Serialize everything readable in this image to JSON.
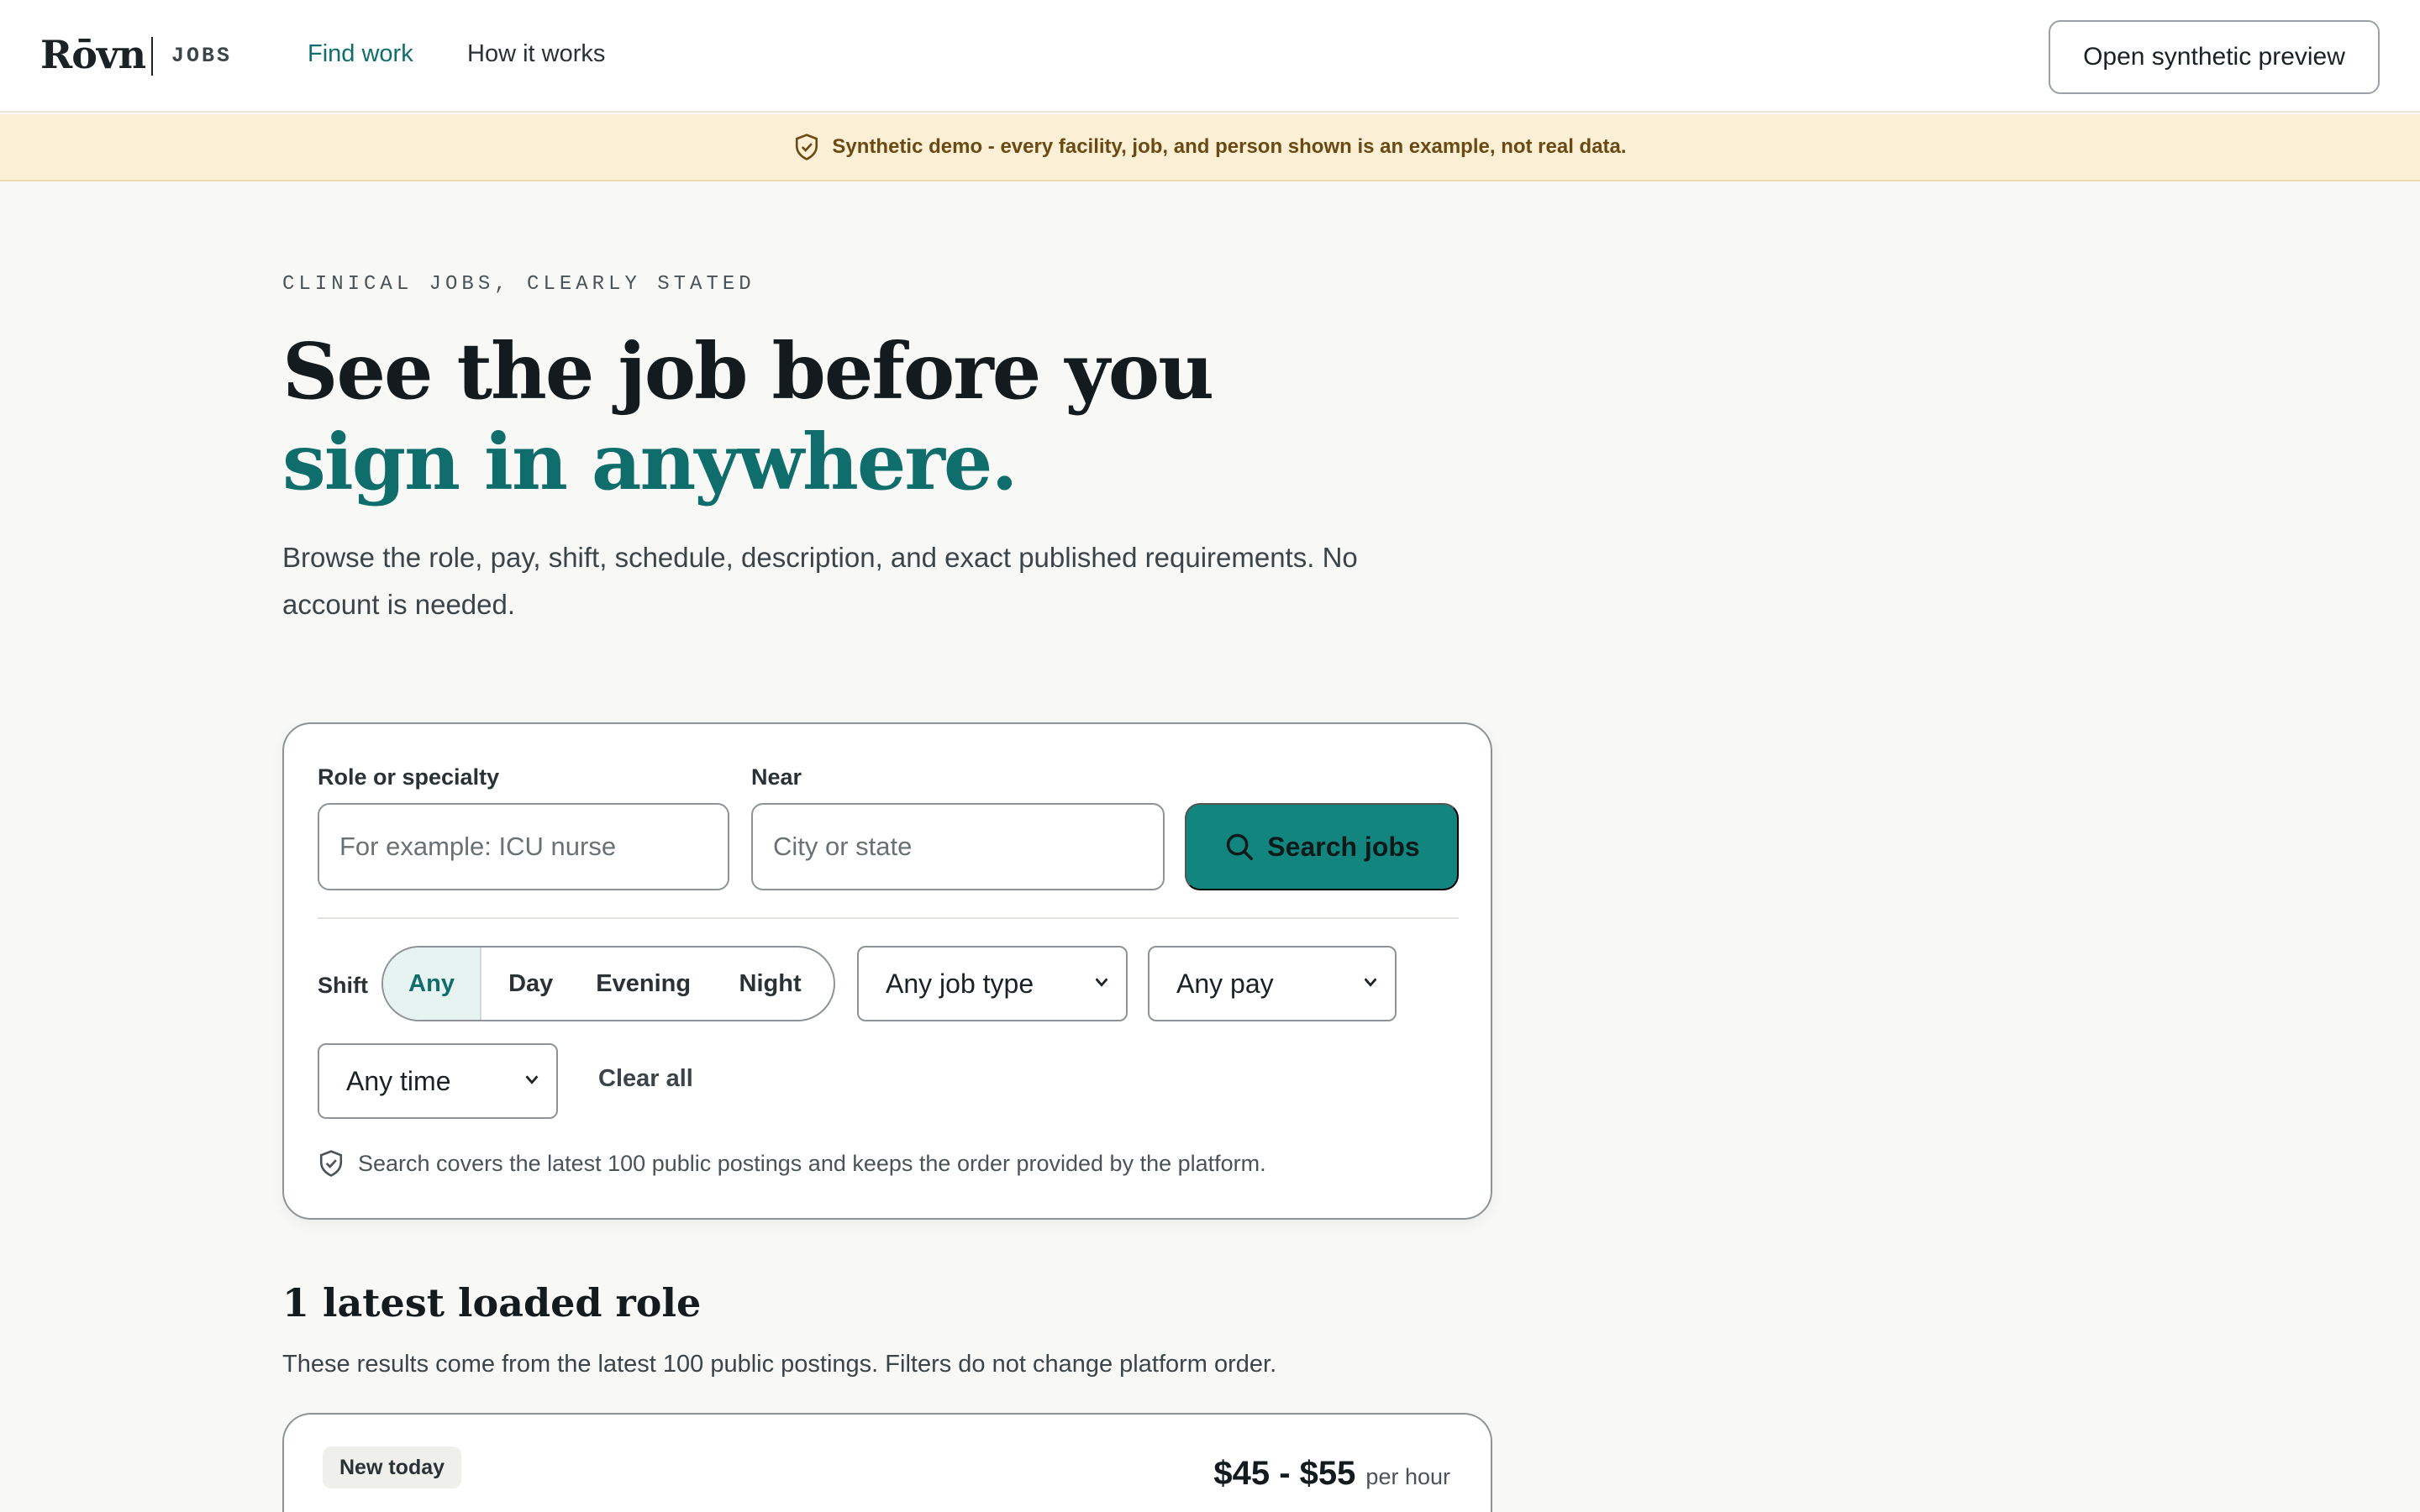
{
  "header": {
    "logo": "Rōvn",
    "logo_sub": "JOBS",
    "nav": [
      {
        "label": "Find work",
        "active": true
      },
      {
        "label": "How it works",
        "active": false
      }
    ],
    "preview_button": "Open synthetic preview"
  },
  "banner": {
    "text": "Synthetic demo - every facility, job, and person shown is an example, not real data.",
    "icon": "shield-check-icon"
  },
  "hero": {
    "eyebrow": "CLINICAL JOBS, CLEARLY STATED",
    "title_main": "See the job before you ",
    "title_accent": "sign in anywhere.",
    "subtitle": "Browse the role, pay, shift, schedule, description, and exact published requirements. No account is needed."
  },
  "search": {
    "role_label": "Role or specialty",
    "role_placeholder": "For example: ICU nurse",
    "near_label": "Near",
    "near_placeholder": "City or state",
    "button": "Search jobs",
    "shift_label": "Shift",
    "shifts": [
      "Any",
      "Day",
      "Evening",
      "Night"
    ],
    "shift_selected": "Any",
    "job_type": "Any job type",
    "pay": "Any pay",
    "time": "Any time",
    "clear_all": "Clear all",
    "note": "Search covers the latest 100 public postings and keeps the order provided by the platform."
  },
  "results": {
    "title": "1 latest loaded role",
    "subtitle": "These results come from the latest 100 public postings. Filters do not change platform order.",
    "jobs": [
      {
        "badge": "New today",
        "pay": "$45 - $55",
        "pay_unit": "per hour"
      }
    ]
  },
  "colors": {
    "accent": "#0f6e6c",
    "button": "#13857f",
    "banner_bg": "#fbefd6"
  }
}
